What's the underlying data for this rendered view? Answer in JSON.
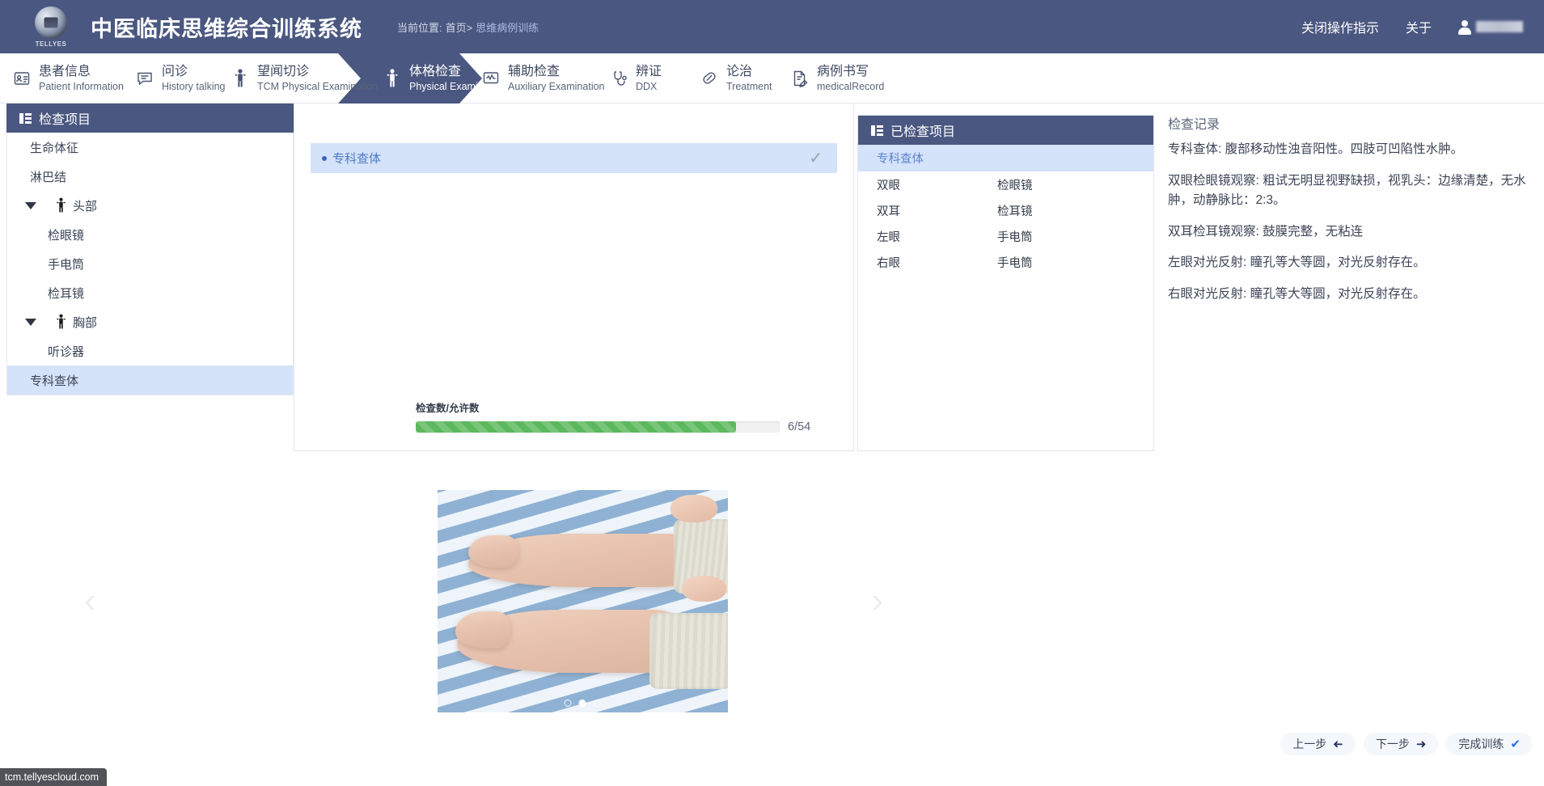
{
  "header": {
    "logo_text": "TELLYES",
    "app_title": "中医临床思维综合训练系统",
    "breadcrumb_prefix": "当前位置:",
    "breadcrumb_home": "首页>",
    "breadcrumb_current": "思维病例训练",
    "close_tips_label": "关闭操作指示",
    "about_label": "关于",
    "user_name": ""
  },
  "nav": {
    "steps": [
      {
        "zh": "患者信息",
        "en": "Patient Information",
        "icon": "id-card-icon",
        "active": false
      },
      {
        "zh": "问诊",
        "en": "History talking",
        "icon": "chat-bubble-icon",
        "active": false
      },
      {
        "zh": "望闻切诊",
        "en": "TCM Physical Examination",
        "icon": "person-icon",
        "active": false
      },
      {
        "zh": "体格检查",
        "en": "Physical Examination",
        "icon": "person-icon",
        "active": true
      },
      {
        "zh": "辅助检查",
        "en": "Auxiliary Examination",
        "icon": "monitor-icon",
        "active": false
      },
      {
        "zh": "辨证",
        "en": "DDX",
        "icon": "stethoscope-icon",
        "active": false
      },
      {
        "zh": "论治",
        "en": "Treatment",
        "icon": "pill-icon",
        "active": false
      },
      {
        "zh": "病例书写",
        "en": "medicalRecord",
        "icon": "document-pen-icon",
        "active": false
      }
    ]
  },
  "left_panel": {
    "title": "检查项目",
    "items": [
      {
        "label": "生命体征",
        "type": "leaf",
        "selected": false
      },
      {
        "label": "淋巴结",
        "type": "leaf",
        "selected": false
      },
      {
        "label": "头部",
        "type": "group",
        "expanded": true,
        "selected": false
      },
      {
        "label": "检眼镜",
        "type": "child",
        "selected": false
      },
      {
        "label": "手电筒",
        "type": "child",
        "selected": false
      },
      {
        "label": "检耳镜",
        "type": "child",
        "selected": false
      },
      {
        "label": "胸部",
        "type": "group",
        "expanded": true,
        "selected": false
      },
      {
        "label": "听诊器",
        "type": "child",
        "selected": false
      },
      {
        "label": "专科查体",
        "type": "leaf",
        "selected": true
      }
    ]
  },
  "center_panel": {
    "selected_item": "专科查体",
    "checked_icon": "check-icon",
    "progress": {
      "label": "检查数/允许数",
      "value_text": "6/54",
      "current": 6,
      "total": 54,
      "percent": 88,
      "color": "#5cb85c"
    }
  },
  "exam_panel": {
    "title": "已检查项目",
    "header_row": "专科查体",
    "rows": [
      {
        "part": "双眼",
        "tool": "检眼镜"
      },
      {
        "part": "双耳",
        "tool": "检耳镜"
      },
      {
        "part": "左眼",
        "tool": "手电筒"
      },
      {
        "part": "右眼",
        "tool": "手电筒"
      }
    ]
  },
  "records_panel": {
    "title": "检查记录",
    "paragraphs": [
      "专科查体: 腹部移动性浊音阳性。四肢可凹陷性水肿。",
      "双眼检眼镜观察: 粗试无明显视野缺损，视乳头：边缘清楚，无水肿，动静脉比：2:3。",
      "双耳检耳镜观察: 鼓膜完整，无粘连",
      "左眼对光反射: 瞳孔等大等圆，对光反射存在。",
      "右眼对光反射: 瞳孔等大等圆，对光反射存在。"
    ]
  },
  "carousel": {
    "prev_icon": "chevron-left-icon",
    "next_icon": "chevron-right-icon",
    "image_alt": "双下肢凹陷性水肿临床照片",
    "dots": [
      {
        "active": false
      },
      {
        "active": true
      },
      {
        "active": false
      }
    ]
  },
  "footer": {
    "prev_label": "上一步",
    "prev_icon": "arrow-left-icon",
    "next_label": "下一步",
    "next_icon": "arrow-right-icon",
    "finish_label": "完成训练",
    "finish_icon": "check-icon"
  },
  "statusbar": {
    "url": "tcm.tellyescloud.com"
  },
  "colors": {
    "brand_dark": "#4a5780",
    "selection": "#d4e2fa",
    "accent_link": "#4f7ac7",
    "progress_green": "#5cb85c"
  }
}
